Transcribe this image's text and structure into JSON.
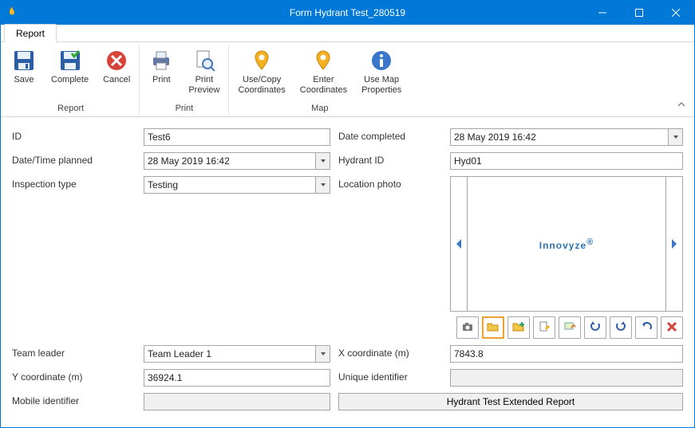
{
  "window": {
    "title": "Form Hydrant Test_280519"
  },
  "tabs": {
    "report": "Report"
  },
  "ribbon": {
    "save": "Save",
    "complete": "Complete",
    "cancel": "Cancel",
    "print": "Print",
    "print_preview": "Print\nPreview",
    "use_copy_coordinates": "Use/Copy\nCoordinates",
    "enter_coordinates": "Enter\nCoordinates",
    "use_map_properties": "Use Map\nProperties",
    "group_report": "Report",
    "group_print": "Print",
    "group_map": "Map"
  },
  "labels": {
    "id": "ID",
    "date_completed": "Date completed",
    "date_time_planned": "Date/Time planned",
    "hydrant_id": "Hydrant ID",
    "inspection_type": "Inspection type",
    "location_photo": "Location photo",
    "team_leader": "Team leader",
    "x_coord": "X coordinate (m)",
    "y_coord": "Y coordinate (m)",
    "unique_identifier": "Unique identifier",
    "mobile_identifier": "Mobile identifier"
  },
  "values": {
    "id": "Test6",
    "date_completed": "28 May 2019 16:42",
    "date_time_planned": "28 May 2019 16:42",
    "hydrant_id": "Hyd01",
    "inspection_type": "Testing",
    "team_leader": "Team Leader 1",
    "x_coord": "7843.8",
    "y_coord": "36924.1",
    "unique_identifier": "",
    "mobile_identifier": ""
  },
  "photo": {
    "brand": "Innovyze",
    "reg": "®"
  },
  "buttons": {
    "extended_report": "Hydrant Test Extended Report"
  }
}
